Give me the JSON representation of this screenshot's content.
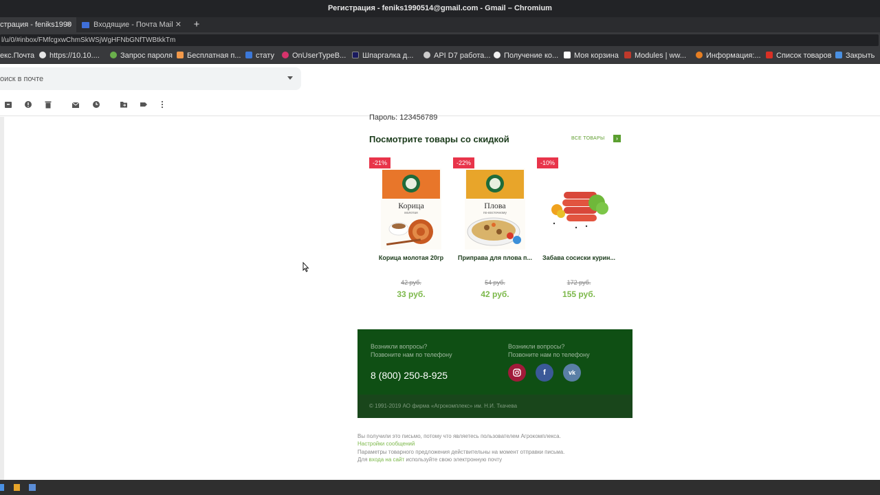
{
  "window": {
    "title": "Регистрация - feniks1990514@gmail.com - Gmail – Chromium"
  },
  "tabs": [
    {
      "label": "страция - feniks1990",
      "active": true
    },
    {
      "label": "Входящие - Почта Mail.ru",
      "active": false
    }
  ],
  "address": {
    "url": "l/u/0/#inbox/FMfcgxwChmSkWSjWgHFNbGNfTWBtkkTm"
  },
  "bookmarks": [
    {
      "label": "екс.Почта",
      "color": "#ff5a3c"
    },
    {
      "label": "https://10.10....",
      "color": "#e6e6e6"
    },
    {
      "label": "Запрос пароля",
      "color": "#6ab04c"
    },
    {
      "label": "Бесплатная п...",
      "color": "#f2994a"
    },
    {
      "label": "стату",
      "color": "#3c78d8"
    },
    {
      "label": "OnUserTypeB...",
      "color": "#d6336c"
    },
    {
      "label": "Шпаргалка д...",
      "color": "#1a1a5e"
    },
    {
      "label": "API D7 работа...",
      "color": "#cccccc"
    },
    {
      "label": "Получение ко...",
      "color": "#f2f2f2"
    },
    {
      "label": "Моя корзина",
      "color": "#ffffff"
    },
    {
      "label": "Modules | ww...",
      "color": "#c0392b"
    },
    {
      "label": "Информация:...",
      "color": "#e67e22"
    },
    {
      "label": "Список товаров",
      "color": "#d93025"
    },
    {
      "label": "Закрыть",
      "color": "#4a90e2"
    }
  ],
  "search": {
    "placeholder": "оиск в почте"
  },
  "email": {
    "password_line": "Пароль: 123456789",
    "section_title": "Посмотрите товары со скидкой",
    "all_products": "ВСЕ ТОВАРЫ",
    "products": [
      {
        "discount": "-21%",
        "name": "Корица молотая 20гр",
        "old_price": "42 руб.",
        "new_price": "33 руб.",
        "pack_text": "Корица",
        "pack_sub": "молотая"
      },
      {
        "discount": "-22%",
        "name": "Приправа для плова п...",
        "old_price": "54 руб.",
        "new_price": "42 руб.",
        "pack_text": "Плова",
        "pack_sub": "по-восточному"
      },
      {
        "discount": "-10%",
        "name": "Забава сосиски курин...",
        "old_price": "172 руб.",
        "new_price": "155 руб."
      }
    ]
  },
  "footer": {
    "question_left": "Возникли вопросы?",
    "call_left": "Позвоните нам по телефону",
    "question_right": "Возникли вопросы?",
    "call_right": "Позвоните нам по телефону",
    "phone": "8 (800) 250-8-925",
    "social": [
      {
        "icon": "instagram-icon",
        "color": "#a11b3a"
      },
      {
        "icon": "facebook-icon",
        "color": "#3b5998",
        "glyph": "f"
      },
      {
        "icon": "vk-icon",
        "color": "#5a7fa6",
        "glyph": "vk"
      }
    ],
    "copyright": "© 1991-2019 АО фирма «Агрокомплекс» им. Н.И. Ткачева"
  },
  "legal": {
    "line1": "Вы получили это письмо, потому что являетесь пользователем Агрокомплекса.",
    "settings_link": "Настройки сообщений",
    "line3": "Параметры товарного предложения действительны на момент отправки письма.",
    "line4_pre": "Для",
    "login_link": "входа на сайт",
    "line4_post": "используйте свою электронную почту"
  },
  "colors": {
    "accent_green": "#7cb84a",
    "footer_bg": "#0f4f14",
    "badge_red": "#e8344a"
  }
}
